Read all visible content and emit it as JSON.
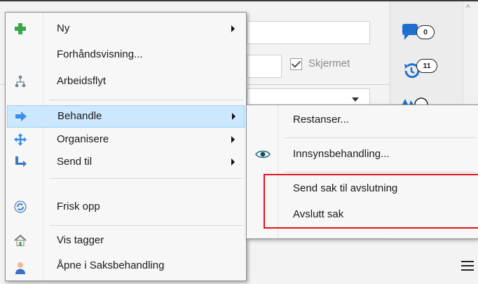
{
  "background": {
    "checkbox_label": "Skjermet",
    "badges": [
      "0",
      "11"
    ]
  },
  "context_menu": {
    "items": [
      {
        "label": "Ny",
        "icon": "green-plus-icon",
        "submenu": true
      },
      {
        "label": "Forhåndsvisning...",
        "icon": null,
        "submenu": false
      },
      {
        "label": "Arbeidsflyt",
        "icon": "workflow-icon",
        "submenu": false
      },
      {
        "label": "Behandle",
        "icon": "blue-arrow-icon",
        "submenu": true,
        "highlighted": true
      },
      {
        "label": "Organisere",
        "icon": "move-arrows-icon",
        "submenu": true
      },
      {
        "label": "Send til",
        "icon": "send-to-icon",
        "submenu": true
      },
      {
        "label": "Frisk opp",
        "icon": "refresh-icon",
        "submenu": false
      },
      {
        "label": "Vis tagger",
        "icon": "house-tag-icon",
        "submenu": false
      },
      {
        "label": "Åpne i Saksbehandling",
        "icon": "person-icon",
        "submenu": false
      }
    ]
  },
  "submenu": {
    "items": [
      {
        "label": "Restanser...",
        "icon": null
      },
      {
        "label": "Innsynsbehandling...",
        "icon": "eye-icon"
      },
      {
        "label": "Send sak til avslutning",
        "icon": null
      },
      {
        "label": "Avslutt sak",
        "icon": null
      }
    ]
  },
  "colors": {
    "highlight_bg": "#cce8ff",
    "highlight_border": "#99d1ff",
    "annotation_red": "#e2141c",
    "accent_blue": "#1f6fd1"
  }
}
